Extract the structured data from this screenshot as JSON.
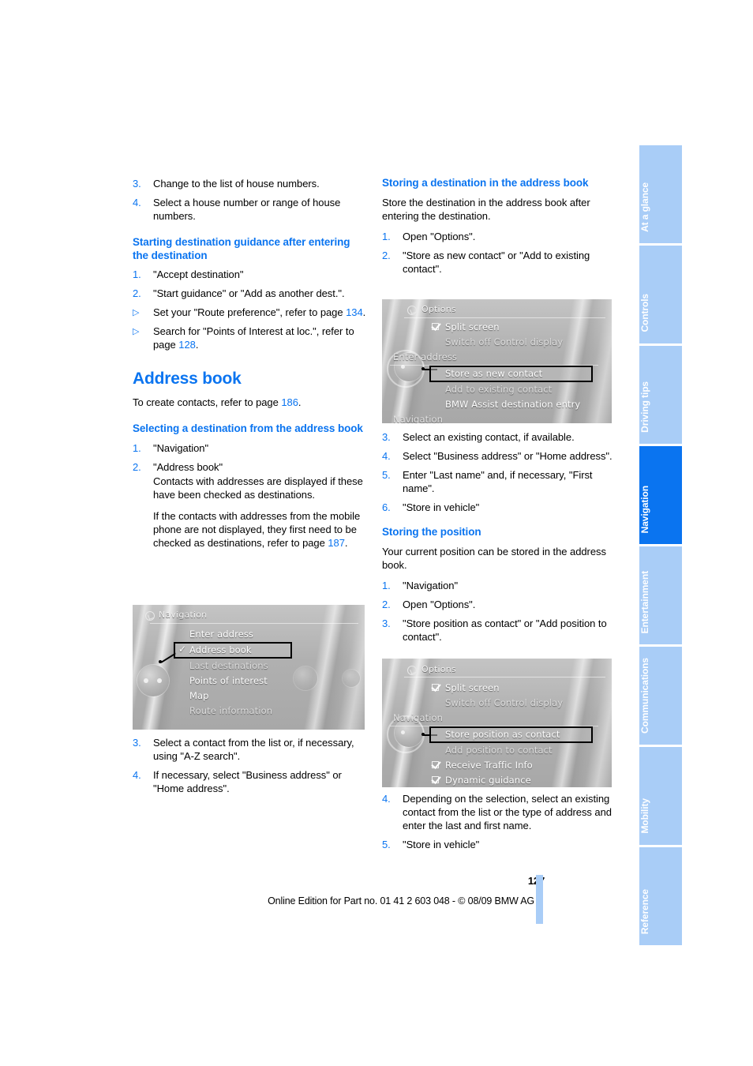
{
  "page": {
    "number": "127",
    "edition_line": "Online Edition for Part no. 01 41 2 603 048 - © 08/09 BMW AG",
    "accent_blue": "#0a74f0",
    "tab_blue_inactive": "#a9cdf7"
  },
  "left_column": {
    "continued_steps": [
      {
        "marker": "3.",
        "text": "Change to the list of house numbers."
      },
      {
        "marker": "4.",
        "text": "Select a house number or range of house numbers."
      }
    ],
    "section_guidance": {
      "heading": "Starting destination guidance after entering the destination",
      "steps": [
        {
          "marker": "1.",
          "text": "\"Accept destination\""
        },
        {
          "marker": "2.",
          "text": "\"Start guidance\" or \"Add as another dest.\"."
        },
        {
          "marker": "▷",
          "text": "Set your \"Route preference\", refer to page ",
          "ref": "134",
          "tail": "."
        },
        {
          "marker": "▷",
          "text": "Search for \"Points of Interest at loc.\", refer to page ",
          "ref": "128",
          "tail": "."
        }
      ]
    },
    "address_book": {
      "heading": "Address book",
      "intro_text": "To create contacts, refer to page ",
      "intro_ref": "186",
      "intro_tail": "."
    },
    "section_selecting": {
      "heading": "Selecting a destination from the address book",
      "steps": [
        {
          "marker": "1.",
          "text": "\"Navigation\""
        },
        {
          "marker": "2.",
          "text": "\"Address book\"",
          "sub1": "Contacts with addresses are displayed if these have been checked as destinations.",
          "sub2_pre": "If the contacts with addresses from the mobile phone are not displayed, they first need to be checked as destinations, refer to page ",
          "sub2_ref": "187",
          "sub2_tail": "."
        }
      ],
      "steps_after_figure": [
        {
          "marker": "3.",
          "text": "Select a contact from the list or, if necessary, using \"A-Z search\"."
        },
        {
          "marker": "4.",
          "text": "If necessary, select \"Business address\" or \"Home address\"."
        }
      ]
    }
  },
  "right_column": {
    "section_storing_destination": {
      "heading": "Storing a destination in the address book",
      "intro": "Store the destination in the address book after entering the destination.",
      "steps_before_figure": [
        {
          "marker": "1.",
          "text": "Open \"Options\"."
        },
        {
          "marker": "2.",
          "text": "\"Store as new contact\" or \"Add to existing contact\"."
        }
      ],
      "steps_after_figure": [
        {
          "marker": "3.",
          "text": "Select an existing contact, if available."
        },
        {
          "marker": "4.",
          "text": "Select \"Business address\" or \"Home address\"."
        },
        {
          "marker": "5.",
          "text": "Enter \"Last name\" and, if necessary, \"First name\"."
        },
        {
          "marker": "6.",
          "text": "\"Store in vehicle\""
        }
      ]
    },
    "section_storing_position": {
      "heading": "Storing the position",
      "intro": "Your current position can be stored in the address book.",
      "steps_before_figure": [
        {
          "marker": "1.",
          "text": "\"Navigation\""
        },
        {
          "marker": "2.",
          "text": "Open \"Options\"."
        },
        {
          "marker": "3.",
          "text": "\"Store position as contact\" or \"Add position to contact\"."
        }
      ],
      "steps_after_figure": [
        {
          "marker": "4.",
          "text": "Depending on the selection, select an existing contact from the list or the type of address and enter the last and first name."
        },
        {
          "marker": "5.",
          "text": "\"Store in vehicle\""
        }
      ]
    }
  },
  "figures": {
    "navigation_menu": {
      "title": "Navigation",
      "items": [
        {
          "label": "Enter address",
          "selected": false,
          "checked": false
        },
        {
          "label": "Address book",
          "selected": true,
          "checked": true
        },
        {
          "label": "Last destinations",
          "selected": false,
          "checked": false
        },
        {
          "label": "Points of interest",
          "selected": false,
          "checked": false
        },
        {
          "label": "Map",
          "selected": false,
          "checked": false
        },
        {
          "label": "Route information",
          "selected": false,
          "checked": false
        }
      ]
    },
    "options_menu_destination": {
      "title": "Options",
      "items": [
        {
          "label": "Split screen",
          "selected": false,
          "checked": true,
          "section": false
        },
        {
          "label": "Switch off Control display",
          "selected": false,
          "checked": false,
          "section": false
        },
        {
          "label": "Enter address",
          "selected": false,
          "checked": false,
          "section": true
        },
        {
          "label": "Store as new contact",
          "selected": true,
          "checked": false,
          "section": false
        },
        {
          "label": "Add to existing contact",
          "selected": false,
          "checked": false,
          "section": false
        },
        {
          "label": "BMW Assist destination entry",
          "selected": false,
          "checked": false,
          "section": false
        },
        {
          "label": "Navigation",
          "selected": false,
          "checked": false,
          "section": true
        }
      ]
    },
    "options_menu_position": {
      "title": "Options",
      "items": [
        {
          "label": "Split screen",
          "selected": false,
          "checked": true,
          "section": false
        },
        {
          "label": "Switch off Control display",
          "selected": false,
          "checked": false,
          "section": false
        },
        {
          "label": "Navigation",
          "selected": false,
          "checked": false,
          "section": true
        },
        {
          "label": "Store position as contact",
          "selected": true,
          "checked": false,
          "section": false
        },
        {
          "label": "Add position to contact",
          "selected": false,
          "checked": false,
          "section": false
        },
        {
          "label": "Receive Traffic Info",
          "selected": false,
          "checked": true,
          "section": false
        },
        {
          "label": "Dynamic guidance",
          "selected": false,
          "checked": true,
          "section": false
        }
      ]
    }
  },
  "tabs": [
    {
      "label": "At a glance",
      "active": false
    },
    {
      "label": "Controls",
      "active": false
    },
    {
      "label": "Driving tips",
      "active": false
    },
    {
      "label": "Navigation",
      "active": true
    },
    {
      "label": "Entertainment",
      "active": false
    },
    {
      "label": "Communications",
      "active": false
    },
    {
      "label": "Mobility",
      "active": false
    },
    {
      "label": "Reference",
      "active": false
    }
  ]
}
